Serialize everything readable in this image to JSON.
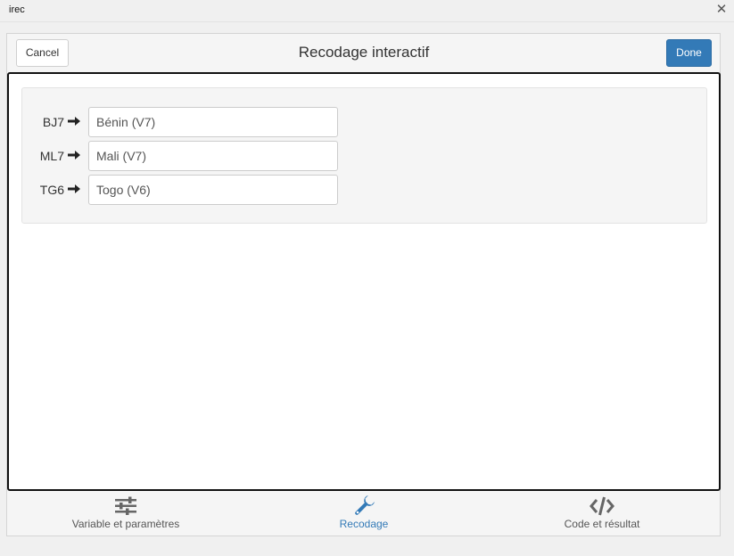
{
  "window": {
    "title": "irec",
    "close_glyph": "✕"
  },
  "header": {
    "title": "Recodage interactif",
    "cancel_label": "Cancel",
    "done_label": "Done"
  },
  "recode": {
    "rows": [
      {
        "from": "BJ7",
        "to": "Bénin (V7)"
      },
      {
        "from": "ML7",
        "to": "Mali (V7)"
      },
      {
        "from": "TG6",
        "to": "Togo (V6)"
      }
    ]
  },
  "tabs": [
    {
      "label": "Variable et paramètres",
      "icon": "sliders-icon",
      "active": false
    },
    {
      "label": "Recodage",
      "icon": "wrench-icon",
      "active": true
    },
    {
      "label": "Code et résultat",
      "icon": "code-icon",
      "active": false
    }
  ],
  "colors": {
    "primary": "#337ab7",
    "text": "#333333",
    "muted": "#555555"
  }
}
